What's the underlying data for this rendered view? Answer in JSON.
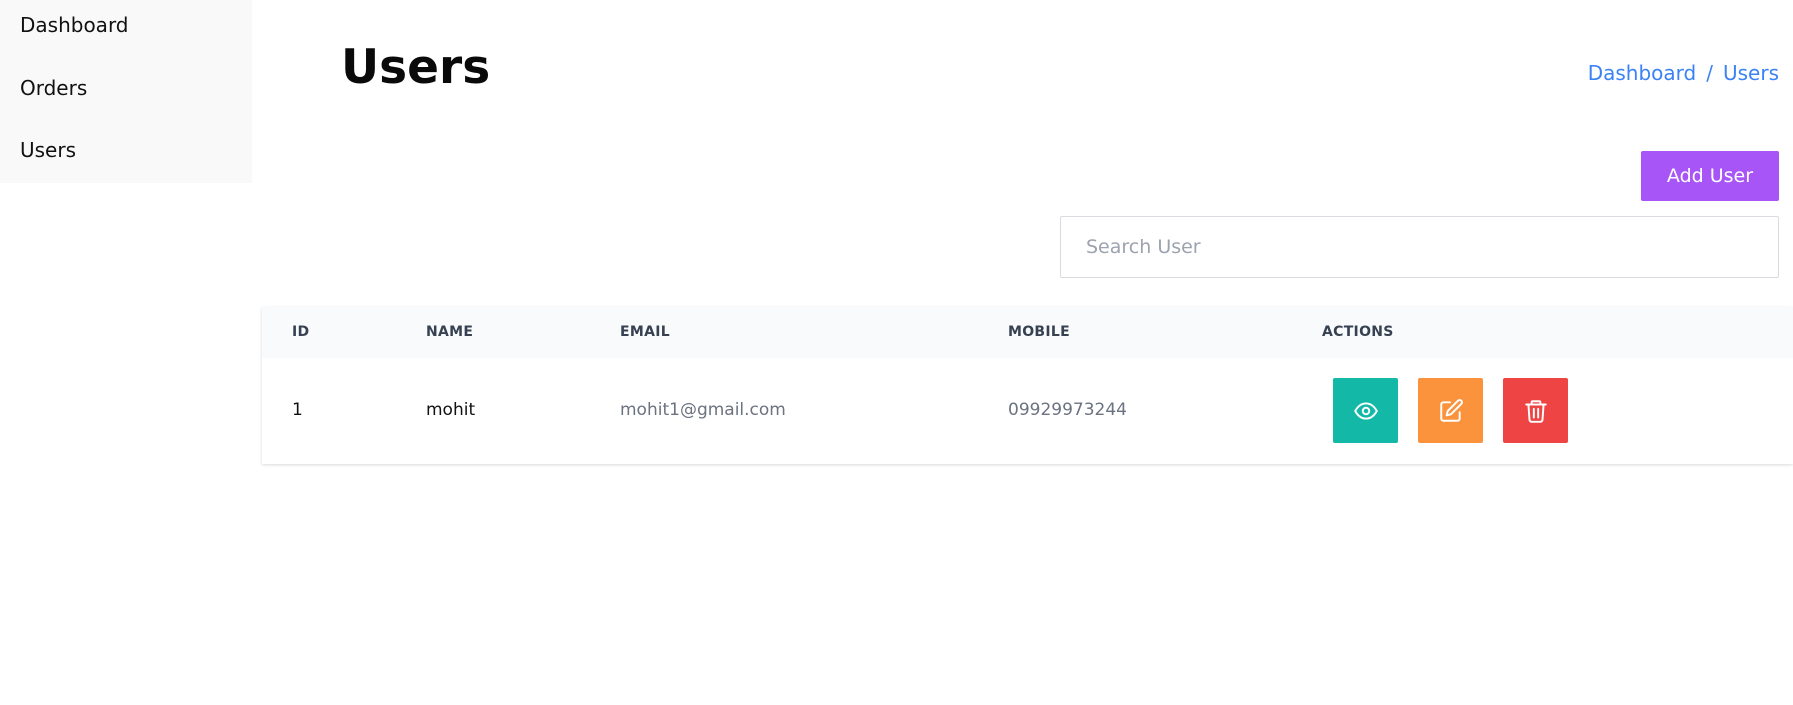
{
  "sidebar": {
    "items": [
      {
        "label": "Dashboard"
      },
      {
        "label": "Orders"
      },
      {
        "label": "Users"
      }
    ]
  },
  "header": {
    "title": "Users"
  },
  "breadcrumb": {
    "items": [
      "Dashboard",
      "Users"
    ],
    "separator": "/"
  },
  "toolbar": {
    "add_label": "Add User"
  },
  "search": {
    "placeholder": "Search User",
    "value": ""
  },
  "table": {
    "columns": [
      "ID",
      "NAME",
      "EMAIL",
      "MOBILE",
      "ACTIONS"
    ],
    "rows": [
      {
        "id": "1",
        "name": "mohit",
        "email": "mohit1@gmail.com",
        "mobile": "09929973244",
        "actions": [
          "eye-icon",
          "edit-icon",
          "trash-icon"
        ]
      }
    ]
  },
  "colors": {
    "accent": "#a855f7",
    "link": "#3b82f6",
    "view": "#14b8a6",
    "edit": "#fb923c",
    "delete": "#ef4444"
  }
}
